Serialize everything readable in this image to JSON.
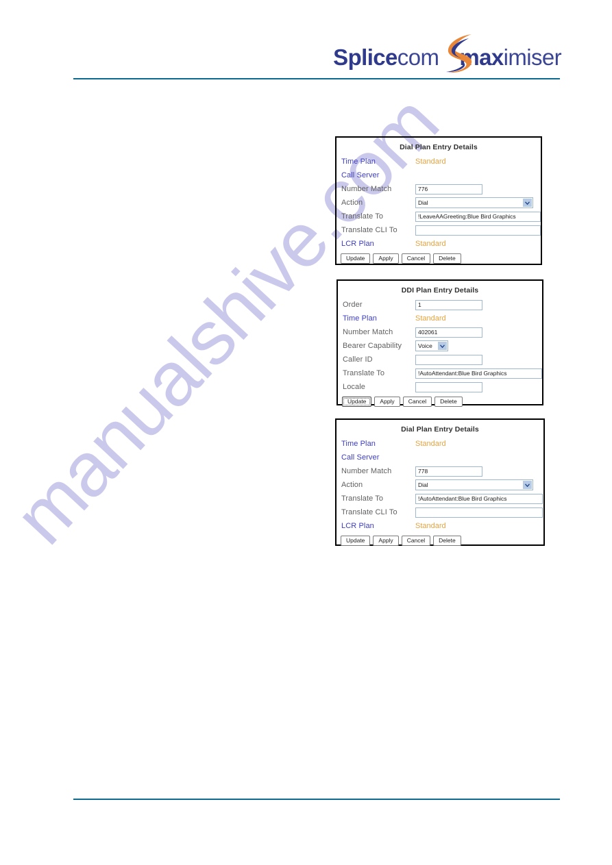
{
  "header": {
    "logo": {
      "part1_bold": "Splice",
      "part2": "com",
      "part3_bold": "max",
      "part4": "imiser",
      "swoosh_color": "#e8873a",
      "text_color": "#2f3a8c"
    },
    "rule_color": "#0d6a8e"
  },
  "watermark": {
    "text": "manualshive.com",
    "color": "#c9c7ea"
  },
  "panels": [
    {
      "id": "dial-plan-entry-details-1",
      "title": "Dial Plan Entry Details",
      "rows": [
        {
          "label": "Time Plan",
          "label_kind": "link",
          "control": "text",
          "value": "Standard"
        },
        {
          "label": "Call Server",
          "label_kind": "link",
          "control": "none",
          "value": ""
        },
        {
          "label": "Number Match",
          "label_kind": "plain",
          "control": "input",
          "value": "776"
        },
        {
          "label": "Action",
          "label_kind": "plain",
          "control": "select",
          "value": "Dial"
        },
        {
          "label": "Translate To",
          "label_kind": "plain",
          "control": "input",
          "value": "!LeaveAAGreeting:Blue Bird Graphics"
        },
        {
          "label": "Translate CLI To",
          "label_kind": "plain",
          "control": "input",
          "value": ""
        },
        {
          "label": "LCR Plan",
          "label_kind": "link",
          "control": "text",
          "value": "Standard"
        }
      ],
      "buttons": [
        "Update",
        "Apply",
        "Cancel",
        "Delete"
      ],
      "focused_button": ""
    },
    {
      "id": "ddi-plan-entry-details",
      "title": "DDI Plan Entry Details",
      "rows": [
        {
          "label": "Order",
          "label_kind": "plain",
          "control": "input",
          "value": "1"
        },
        {
          "label": "Time Plan",
          "label_kind": "link",
          "control": "text",
          "value": "Standard"
        },
        {
          "label": "Number Match",
          "label_kind": "plain",
          "control": "input",
          "value": "402061"
        },
        {
          "label": "Bearer Capability",
          "label_kind": "plain",
          "control": "select-tiny",
          "value": "Voice"
        },
        {
          "label": "Caller ID",
          "label_kind": "plain",
          "control": "input",
          "value": ""
        },
        {
          "label": "Translate To",
          "label_kind": "plain",
          "control": "input",
          "value": "!AutoAttendant:Blue Bird Graphics"
        },
        {
          "label": "Locale",
          "label_kind": "plain",
          "control": "input",
          "value": ""
        }
      ],
      "buttons": [
        "Update",
        "Apply",
        "Cancel",
        "Delete"
      ],
      "focused_button": "Update"
    },
    {
      "id": "dial-plan-entry-details-2",
      "title": "Dial Plan Entry Details",
      "rows": [
        {
          "label": "Time Plan",
          "label_kind": "link",
          "control": "text",
          "value": "Standard"
        },
        {
          "label": "Call Server",
          "label_kind": "link",
          "control": "none",
          "value": ""
        },
        {
          "label": "Number Match",
          "label_kind": "plain",
          "control": "input",
          "value": "778"
        },
        {
          "label": "Action",
          "label_kind": "plain",
          "control": "select",
          "value": "Dial"
        },
        {
          "label": "Translate To",
          "label_kind": "plain",
          "control": "input",
          "value": "!AutoAttendant:Blue Bird Graphics"
        },
        {
          "label": "Translate CLI To",
          "label_kind": "plain",
          "control": "input",
          "value": ""
        },
        {
          "label": "LCR Plan",
          "label_kind": "link",
          "control": "text",
          "value": "Standard"
        }
      ],
      "buttons": [
        "Update",
        "Apply",
        "Cancel",
        "Delete"
      ],
      "focused_button": ""
    }
  ]
}
